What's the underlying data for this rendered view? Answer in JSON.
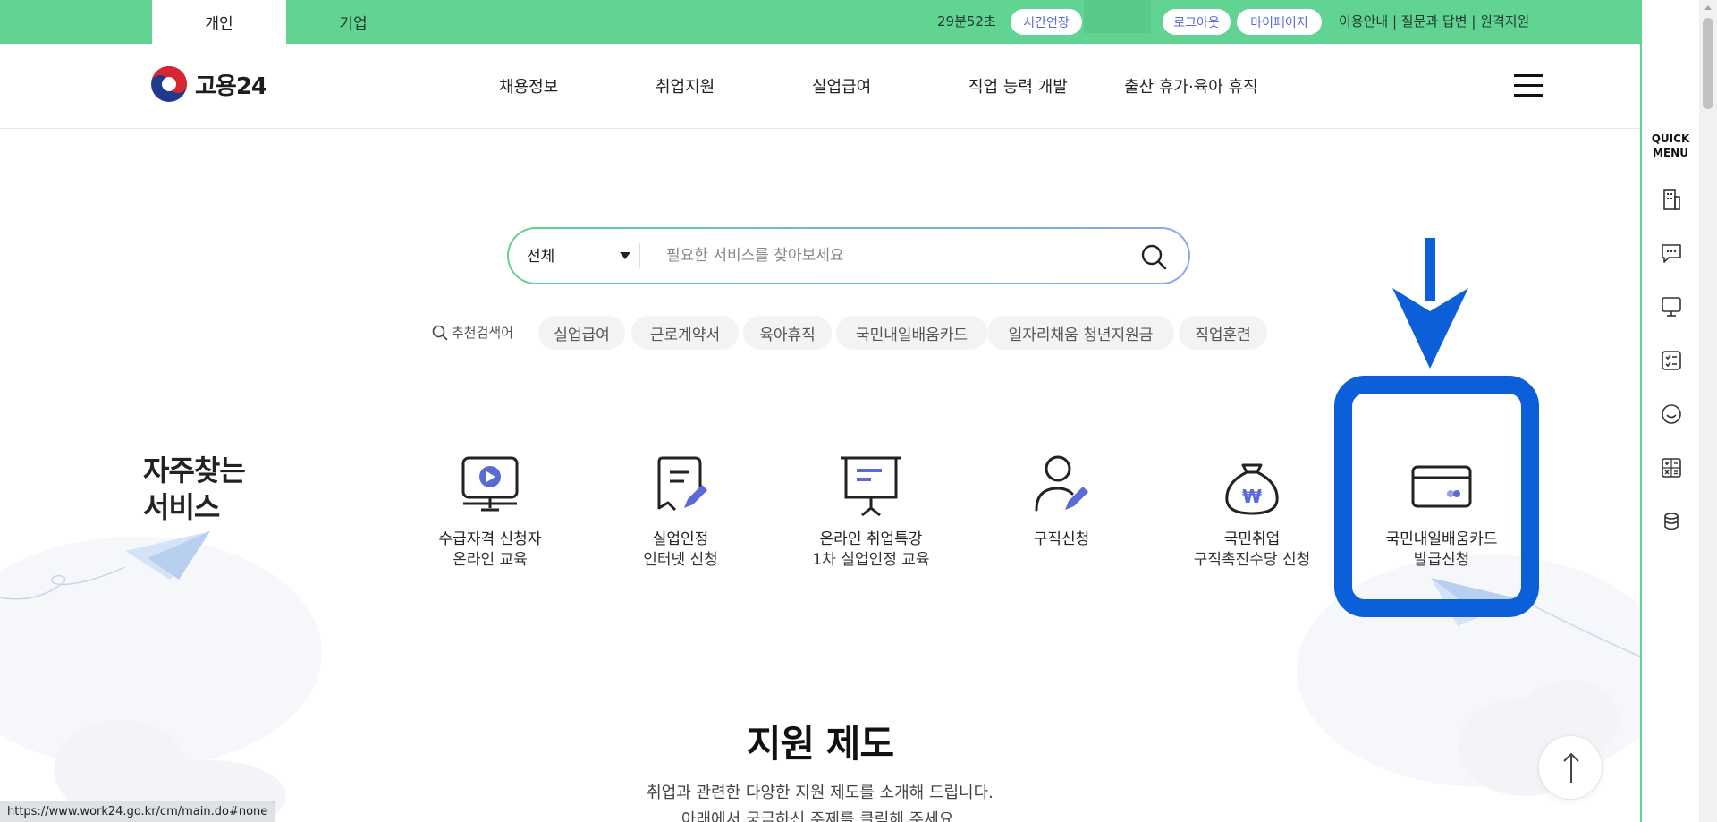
{
  "top_tabs": [
    {
      "label": "개인",
      "active": true
    },
    {
      "label": "기업",
      "active": false
    }
  ],
  "session": {
    "timer": "29분52초",
    "extend_label": "시간연장",
    "logout_label": "로그아웃",
    "mypage_label": "마이페이지",
    "links": "이용안내 | 질문과 답변 | 원격지원"
  },
  "logo": {
    "text": "고용24"
  },
  "nav": [
    "채용정보",
    "취업지원",
    "실업급여",
    "직업 능력 개발",
    "출산 휴가·육아 휴직"
  ],
  "search": {
    "category": "전체",
    "placeholder": "필요한 서비스를 찾아보세요"
  },
  "keywords": {
    "label": "추천검색어",
    "items": [
      "실업급여",
      "근로계약서",
      "육아휴직",
      "국민내일배움카드",
      "일자리채움 청년지원금",
      "직업훈련"
    ]
  },
  "frequent": {
    "title_line1": "자주찾는",
    "title_line2": "서비스",
    "items": [
      {
        "line1": "수급자격 신청자",
        "line2": "온라인 교육",
        "icon": "monitor-play-icon"
      },
      {
        "line1": "실업인정",
        "line2": "인터넷 신청",
        "icon": "document-pen-icon"
      },
      {
        "line1": "온라인 취업특강",
        "line2": "1차 실업인정 교육",
        "icon": "presentation-board-icon"
      },
      {
        "line1": "구직신청",
        "line2": "",
        "icon": "person-pen-icon"
      },
      {
        "line1": "국민취업",
        "line2": "구직촉진수당 신청",
        "icon": "money-bag-icon"
      },
      {
        "line1": "국민내일배움카드",
        "line2": "발급신청",
        "icon": "card-icon"
      }
    ]
  },
  "section": {
    "title": "지원 제도",
    "subtitle": "취업과 관련한 다양한 지원 제도를 소개해 드립니다.",
    "subtitle2": "아래에서 궁금하신 주제를 클릭해 주세요."
  },
  "quick_menu": {
    "title_line1": "QUICK",
    "title_line2": "MENU",
    "icons": [
      "building-icon",
      "chat-icon",
      "monitor-icon",
      "checklist-icon",
      "smile-icon",
      "calculator-icon",
      "coins-icon"
    ]
  },
  "status_url": "https://www.work24.go.kr/cm/main.do#none",
  "colors": {
    "brand_green": "#61d393",
    "highlight_blue": "#0b5fd8",
    "accent_indigo": "#5b6bd6"
  }
}
